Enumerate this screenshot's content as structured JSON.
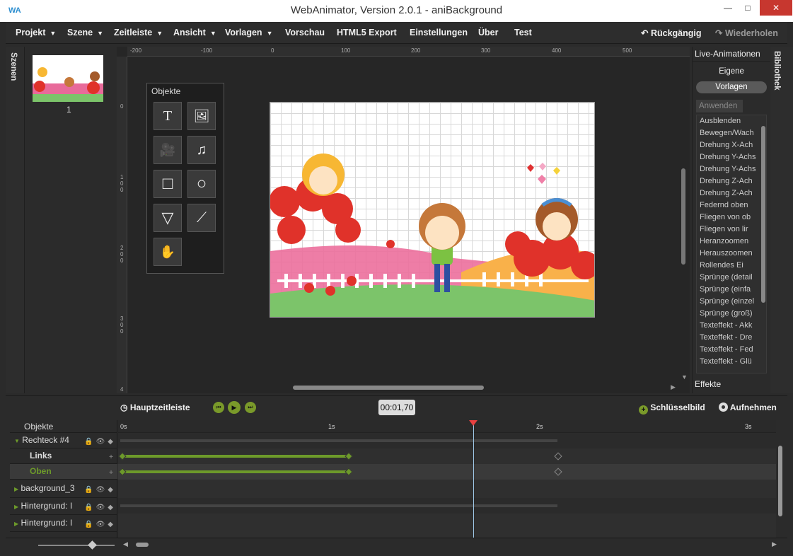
{
  "window": {
    "title": "WebAnimator, Version 2.0.1 - aniBackground",
    "logo": "WA",
    "minimize": "—",
    "maximize": "□",
    "close": "✕"
  },
  "menu": {
    "items": [
      {
        "label": "Projekt",
        "arrow": true
      },
      {
        "label": "Szene",
        "arrow": true
      },
      {
        "label": "Zeitleiste",
        "arrow": true
      },
      {
        "label": "Ansicht",
        "arrow": true
      },
      {
        "label": "Vorlagen",
        "arrow": true
      },
      {
        "label": "Vorschau",
        "arrow": false
      },
      {
        "label": "HTML5 Export",
        "arrow": false
      },
      {
        "label": "Einstellungen",
        "arrow": false
      },
      {
        "label": "Über",
        "arrow": false
      },
      {
        "label": "Test",
        "arrow": false
      }
    ],
    "undo": "Rückgängig",
    "redo": "Wiederholen",
    "arrow_glyph": "▼"
  },
  "scenes": {
    "tab_label": "Szenen",
    "thumb_number": "1"
  },
  "rulers": {
    "top": [
      "-200",
      "-100",
      "0",
      "100",
      "200",
      "300",
      "400",
      "500"
    ],
    "left": [
      "0",
      "1\n0\n0",
      "2\n0\n0",
      "3\n0\n0",
      "4"
    ]
  },
  "objects_panel": {
    "title": "Objekte",
    "tools": [
      "T",
      "🖼",
      "🎥",
      "♫",
      "□",
      "○",
      "▽",
      "⟋",
      "✋"
    ]
  },
  "right_panel": {
    "header": "Live-Animationen",
    "tab_own": "Eigene",
    "tab_templates": "Vorlagen",
    "apply": "Anwenden",
    "animations": [
      "Ausblenden",
      "Bewegen/Wach",
      "Drehung X-Ach",
      "Drehung Y-Achs",
      "Drehung Y-Achs",
      "Drehung Z-Ach",
      "Drehung Z-Ach",
      "Federnd oben",
      "Fliegen von ob",
      "Fliegen von lir",
      "Heranzoomen",
      "Herauszoomen",
      "Rollendes Ei",
      "Sprünge (detail",
      "Sprünge (einfa",
      "Sprünge (einzel",
      "Sprünge (groß)",
      "Texteffekt - Akk",
      "Texteffekt - Dre",
      "Texteffekt - Fed",
      "Texteffekt - Glü"
    ],
    "effects": "Effekte",
    "library_tab": "Bibliothek"
  },
  "timeline": {
    "main_label": "Hauptzeitleiste",
    "time": "00:01,70",
    "keyframe_label": "Schlüsselbild",
    "record_label": "Aufnehmen",
    "objects_header": "Objekte",
    "rows": [
      {
        "label": "Rechteck #4",
        "type": "group"
      },
      {
        "label": "Links",
        "type": "property"
      },
      {
        "label": "Oben",
        "type": "property-active"
      },
      {
        "label": "background_3",
        "type": "object"
      },
      {
        "label": "Hintergrund: I",
        "type": "object"
      },
      {
        "label": "Hintergrund: I",
        "type": "object"
      }
    ],
    "ruler_labels": [
      "0s",
      "1s",
      "2s",
      "3s"
    ],
    "colors": {
      "green": "#6d9a2a",
      "playhead": "#e84040"
    }
  }
}
